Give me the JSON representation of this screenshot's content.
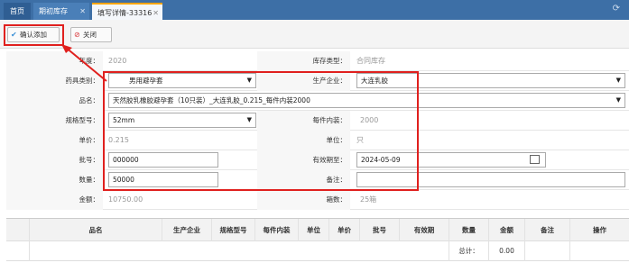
{
  "tabs": [
    {
      "label": "首页"
    },
    {
      "label": "期初库存"
    },
    {
      "label": "填写详情-33316"
    }
  ],
  "toolbar": {
    "confirm_label": "确认添加",
    "close_label": "关闭"
  },
  "form": {
    "year": {
      "label": "年度：",
      "value": "2020"
    },
    "stock_type": {
      "label": "库存类型：",
      "value": "合同库存"
    },
    "drug_category": {
      "label": "药具类别：",
      "value": "男用避孕套"
    },
    "manufacturer": {
      "label": "生产企业：",
      "value": "大连乳胶"
    },
    "product_name": {
      "label": "品名：",
      "value": "天然胶乳橡胶避孕套（10只装）_大连乳胶_0.215_每件内装2000"
    },
    "spec": {
      "label": "规格型号：",
      "value": "52mm"
    },
    "per_case": {
      "label": "每件内装：",
      "value": "2000"
    },
    "unit_price": {
      "label": "单价：",
      "value": "0.215"
    },
    "unit": {
      "label": "单位：",
      "value": "只"
    },
    "batch_no": {
      "label": "批号：",
      "value": "000000"
    },
    "expiry": {
      "label": "有效期至：",
      "value": "2024-05-09"
    },
    "quantity": {
      "label": "数量：",
      "value": "50000"
    },
    "remark": {
      "label": "备注：",
      "value": ""
    },
    "amount": {
      "label": "金额：",
      "value": "10750.00"
    },
    "cases": {
      "label": "箱数：",
      "value": "25箱"
    }
  },
  "table": {
    "headers": [
      "品名",
      "生产企业",
      "规格型号",
      "每件内装",
      "单位",
      "单价",
      "批号",
      "有效期",
      "数量",
      "金额",
      "备注",
      "操作"
    ],
    "total_label": "总计：",
    "total_amount": "0.00"
  },
  "colors": {
    "tabbar": "#3d6fa6",
    "annotation": "#e0201e",
    "active_tab_accent": "#ffa500"
  }
}
